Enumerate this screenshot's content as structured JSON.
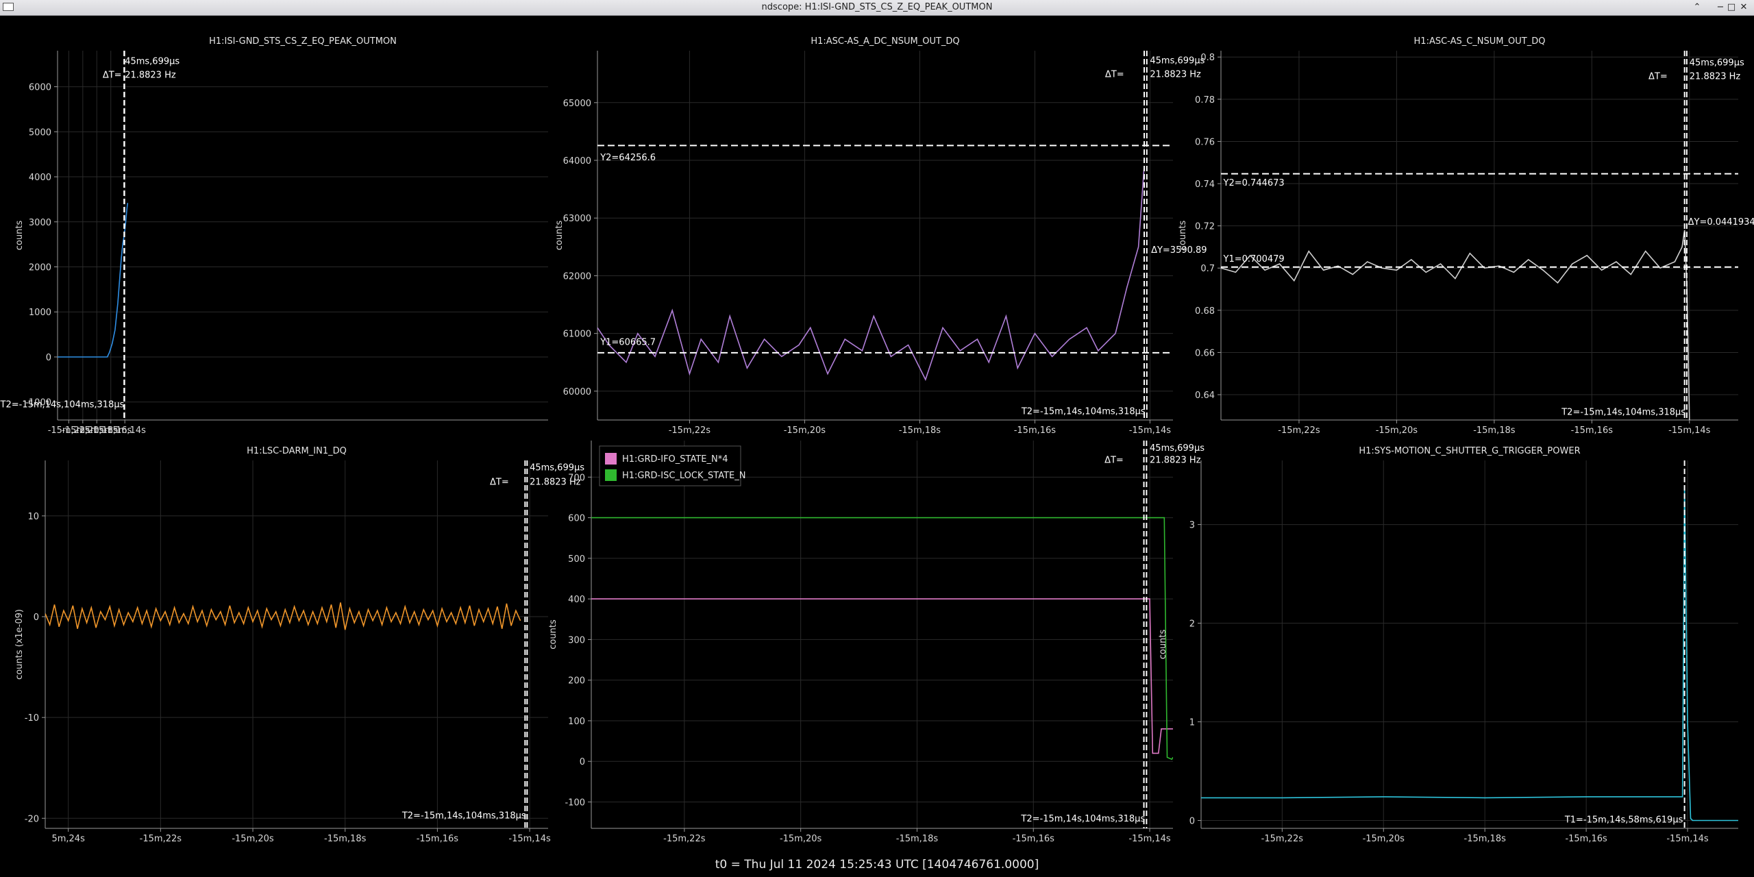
{
  "window": {
    "title": "ndscope: H1:ISI-GND_STS_CS_Z_EQ_PEAK_OUTMON"
  },
  "footer": {
    "t0": "t0 = Thu Jul 11 2024 15:25:43 UTC [1404746761.0000]"
  },
  "colors": {
    "background": "#000000",
    "grid": "#2a2a2a",
    "axis": "#9a9a9a",
    "cursor": "#ffffff"
  },
  "chart_data": [
    {
      "id": "p1",
      "type": "line",
      "title": "H1:ISI-GND_STS_CS_Z_EQ_PEAK_OUTMON",
      "ylabel": "counts",
      "xlim": [
        -923.6,
        -853.6
      ],
      "ylim": [
        -1400,
        6800
      ],
      "xticks": [
        -922,
        -920,
        -918,
        -916,
        -914
      ],
      "xtick_labels": [
        "-15m,22s",
        "-15m,20s",
        "-15m,18s",
        "-15m,16s",
        "-15m,14s"
      ],
      "yticks": [
        -1000,
        0,
        1000,
        2000,
        3000,
        4000,
        5000,
        6000
      ],
      "ytick_labels": [
        "-1000",
        "0",
        "1000",
        "2000",
        "3000",
        "4000",
        "5000",
        "6000"
      ],
      "series": [
        {
          "color": "#2f8fe6",
          "x": [
            -923.6,
            -916.5,
            -916.2,
            -915.8,
            -915.4,
            -915.0,
            -914.7,
            -914.5,
            -914.3,
            -914.1,
            -913.9,
            -913.7,
            -913.6
          ],
          "y": [
            0,
            0,
            100,
            300,
            600,
            1200,
            1800,
            2200,
            2500,
            2700,
            2950,
            3300,
            3420
          ]
        }
      ],
      "vcursors": [
        -914.1,
        -914.055
      ],
      "hcursors": [],
      "annotations": [
        {
          "text": "ΔT=",
          "x": -914.45,
          "y": 6200,
          "anchor": "end"
        },
        {
          "text": "45ms,699μs",
          "x": -914.0,
          "y": 6500,
          "anchor": "start"
        },
        {
          "text": "21.8823 Hz",
          "x": -914.0,
          "y": 6200,
          "anchor": "start"
        },
        {
          "text": "T2=-15m,14s,104ms,318μs",
          "x": -914.08,
          "y": -1120,
          "anchor": "end"
        }
      ]
    },
    {
      "id": "p2",
      "type": "line",
      "title": "H1:ASC-AS_A_DC_NSUM_OUT_DQ",
      "ylabel": "counts",
      "xlim": [
        -923.6,
        -913.6
      ],
      "ylim": [
        59500,
        65900
      ],
      "xticks": [
        -922,
        -920,
        -918,
        -916,
        -914
      ],
      "xtick_labels": [
        "-15m,22s",
        "-15m,20s",
        "-15m,18s",
        "-15m,16s",
        "-15m,14s"
      ],
      "yticks": [
        60000,
        61000,
        62000,
        63000,
        64000,
        65000
      ],
      "ytick_labels": [
        "60000",
        "61000",
        "62000",
        "63000",
        "64000",
        "65000"
      ],
      "series": [
        {
          "color": "#b07fd8",
          "x": [
            -923.6,
            -923.4,
            -923.1,
            -922.9,
            -922.6,
            -922.3,
            -922.0,
            -921.8,
            -921.5,
            -921.3,
            -921.0,
            -920.7,
            -920.4,
            -920.1,
            -919.9,
            -919.6,
            -919.3,
            -919.0,
            -918.8,
            -918.5,
            -918.2,
            -917.9,
            -917.6,
            -917.3,
            -917.0,
            -916.8,
            -916.5,
            -916.3,
            -916.0,
            -915.7,
            -915.4,
            -915.1,
            -914.9,
            -914.6,
            -914.4,
            -914.2,
            -914.1
          ],
          "y": [
            61100,
            60800,
            60500,
            61000,
            60600,
            61400,
            60300,
            60900,
            60500,
            61300,
            60400,
            60900,
            60600,
            60800,
            61100,
            60300,
            60900,
            60700,
            61300,
            60600,
            60800,
            60200,
            61100,
            60700,
            60900,
            60500,
            61300,
            60400,
            61000,
            60600,
            60900,
            61100,
            60700,
            61000,
            61800,
            62500,
            63900
          ]
        }
      ],
      "vcursors": [
        -914.1,
        -914.055
      ],
      "hcursors": [
        64256.6,
        60665.7
      ],
      "annotations": [
        {
          "text": "ΔT=",
          "x": -914.45,
          "y": 65440,
          "anchor": "end"
        },
        {
          "text": "45ms,699μs",
          "x": -914.0,
          "y": 65680,
          "anchor": "start"
        },
        {
          "text": "21.8823 Hz",
          "x": -914.0,
          "y": 65440,
          "anchor": "start"
        },
        {
          "text": "Y2=64256.6",
          "x": -923.55,
          "y": 64000,
          "anchor": "start"
        },
        {
          "text": "Y1=60665.7",
          "x": -923.55,
          "y": 60800,
          "anchor": "start"
        },
        {
          "text": "ΔY=3590.89",
          "x": -913.98,
          "y": 62400,
          "anchor": "start"
        },
        {
          "text": "T2=-15m,14s,104ms,318μs",
          "x": -914.08,
          "y": 59600,
          "anchor": "end"
        }
      ]
    },
    {
      "id": "p3",
      "type": "line",
      "title": "H1:ASC-AS_C_NSUM_OUT_DQ",
      "ylabel": "counts",
      "xlim": [
        -923.6,
        -913.0
      ],
      "ylim": [
        0.628,
        0.803
      ],
      "xticks": [
        -922,
        -920,
        -918,
        -916,
        -914
      ],
      "xtick_labels": [
        "-15m,22s",
        "-15m,20s",
        "-15m,18s",
        "-15m,16s",
        "-15m,14s"
      ],
      "yticks": [
        0.64,
        0.66,
        0.68,
        0.7,
        0.72,
        0.74,
        0.76,
        0.78,
        0.8
      ],
      "ytick_labels": [
        "0.64",
        "0.66",
        "0.68",
        "0.7",
        "0.72",
        "0.74",
        "0.76",
        "0.78",
        "0.8"
      ],
      "series": [
        {
          "color": "#cfcfcf",
          "x": [
            -923.6,
            -923.3,
            -923.0,
            -922.7,
            -922.4,
            -922.1,
            -921.8,
            -921.5,
            -921.2,
            -920.9,
            -920.6,
            -920.3,
            -920.0,
            -919.7,
            -919.4,
            -919.1,
            -918.8,
            -918.5,
            -918.2,
            -917.9,
            -917.6,
            -917.3,
            -917.0,
            -916.7,
            -916.4,
            -916.1,
            -915.8,
            -915.5,
            -915.2,
            -914.9,
            -914.6,
            -914.3,
            -914.15,
            -914.1,
            -914.05,
            -914.0
          ],
          "y": [
            0.7,
            0.698,
            0.706,
            0.699,
            0.702,
            0.694,
            0.708,
            0.699,
            0.701,
            0.697,
            0.703,
            0.7,
            0.699,
            0.704,
            0.698,
            0.702,
            0.695,
            0.707,
            0.7,
            0.701,
            0.698,
            0.704,
            0.699,
            0.693,
            0.702,
            0.706,
            0.699,
            0.703,
            0.697,
            0.708,
            0.7,
            0.703,
            0.71,
            0.718,
            0.69,
            0.628
          ]
        }
      ],
      "vcursors": [
        -914.1,
        -914.055
      ],
      "hcursors": [
        0.744673,
        0.700479
      ],
      "annotations": [
        {
          "text": "ΔT=",
          "x": -914.45,
          "y": 0.7895,
          "anchor": "end"
        },
        {
          "text": "45ms,699μs",
          "x": -914.0,
          "y": 0.796,
          "anchor": "start"
        },
        {
          "text": "21.8823 Hz",
          "x": -914.0,
          "y": 0.7895,
          "anchor": "start"
        },
        {
          "text": "Y2=0.744673",
          "x": -923.55,
          "y": 0.739,
          "anchor": "start"
        },
        {
          "text": "Y1=0.700479",
          "x": -923.55,
          "y": 0.703,
          "anchor": "start"
        },
        {
          "text": "ΔY=0.0441934",
          "x": -914.03,
          "y": 0.7205,
          "anchor": "start"
        },
        {
          "text": "T2=-15m,14s,104ms,318μs",
          "x": -914.08,
          "y": 0.6305,
          "anchor": "end"
        }
      ]
    },
    {
      "id": "p4",
      "type": "line",
      "title": "H1:LSC-DARM_IN1_DQ",
      "ylabel": "counts (x1e-09)",
      "xlim": [
        -924.5,
        -913.6
      ],
      "ylim": [
        -21,
        15.5
      ],
      "xticks": [
        -924,
        -922,
        -920,
        -918,
        -916,
        -914
      ],
      "xtick_labels": [
        "5m,24s",
        "-15m,22s",
        "-15m,20s",
        "-15m,18s",
        "-15m,16s",
        "-15m,14s"
      ],
      "yticks": [
        -20,
        -10,
        0,
        10
      ],
      "ytick_labels": [
        "-20",
        "-10",
        "0",
        "10"
      ],
      "series": [
        {
          "color": "#f0962a",
          "x": [
            -924.5,
            -924.4,
            -924.3,
            -924.2,
            -924.1,
            -924.0,
            -923.9,
            -923.8,
            -923.7,
            -923.6,
            -923.5,
            -923.4,
            -923.3,
            -923.2,
            -923.1,
            -923.0,
            -922.9,
            -922.8,
            -922.7,
            -922.6,
            -922.5,
            -922.4,
            -922.3,
            -922.2,
            -922.1,
            -922.0,
            -921.9,
            -921.8,
            -921.7,
            -921.6,
            -921.5,
            -921.4,
            -921.3,
            -921.2,
            -921.1,
            -921.0,
            -920.9,
            -920.8,
            -920.7,
            -920.6,
            -920.5,
            -920.4,
            -920.3,
            -920.2,
            -920.1,
            -920.0,
            -919.9,
            -919.8,
            -919.7,
            -919.6,
            -919.5,
            -919.4,
            -919.3,
            -919.2,
            -919.1,
            -919.0,
            -918.9,
            -918.8,
            -918.7,
            -918.6,
            -918.5,
            -918.4,
            -918.3,
            -918.2,
            -918.1,
            -918.0,
            -917.9,
            -917.8,
            -917.7,
            -917.6,
            -917.5,
            -917.4,
            -917.3,
            -917.2,
            -917.1,
            -917.0,
            -916.9,
            -916.8,
            -916.7,
            -916.6,
            -916.5,
            -916.4,
            -916.3,
            -916.2,
            -916.1,
            -916.0,
            -915.9,
            -915.8,
            -915.7,
            -915.6,
            -915.5,
            -915.4,
            -915.3,
            -915.2,
            -915.1,
            -915.0,
            -914.9,
            -914.8,
            -914.7,
            -914.6,
            -914.5,
            -914.4,
            -914.3,
            -914.2
          ],
          "y": [
            0.3,
            -0.8,
            1.2,
            -1.0,
            0.6,
            -0.4,
            1.1,
            -1.2,
            0.8,
            -0.6,
            0.9,
            -1.1,
            0.5,
            -0.3,
            1.0,
            -0.9,
            0.7,
            -0.8,
            0.4,
            -0.5,
            0.9,
            -0.7,
            0.6,
            -1.0,
            0.8,
            -0.4,
            0.5,
            -0.8,
            0.9,
            -0.6,
            0.3,
            -0.7,
            1.0,
            -0.5,
            0.6,
            -0.9,
            0.7,
            -0.3,
            0.5,
            -0.8,
            1.1,
            -0.6,
            0.4,
            -0.7,
            0.9,
            -0.5,
            0.6,
            -1.0,
            0.8,
            -0.3,
            0.5,
            -0.9,
            0.7,
            -0.6,
            1.0,
            -0.4,
            0.6,
            -0.8,
            0.5,
            -0.7,
            0.9,
            -0.5,
            1.2,
            -1.1,
            1.4,
            -1.3,
            0.8,
            -0.6,
            0.5,
            -0.9,
            0.7,
            -0.4,
            0.6,
            -0.8,
            0.9,
            -0.5,
            0.4,
            -0.7,
            1.0,
            -0.6,
            0.5,
            -0.8,
            0.7,
            -0.3,
            0.6,
            -0.9,
            0.8,
            -0.5,
            0.4,
            -0.7,
            0.9,
            -0.6,
            1.1,
            -0.9,
            0.7,
            -0.5,
            0.8,
            -0.7,
            1.0,
            -1.2,
            1.3,
            -0.9,
            0.6,
            -0.4
          ]
        }
      ],
      "vcursors": [
        -914.1,
        -914.055
      ],
      "hcursors": [],
      "annotations": [
        {
          "text": "ΔT=",
          "x": -914.45,
          "y": 13.1,
          "anchor": "end"
        },
        {
          "text": "45ms,699μs",
          "x": -914.0,
          "y": 14.5,
          "anchor": "start"
        },
        {
          "text": "21.8823 Hz",
          "x": -914.0,
          "y": 13.1,
          "anchor": "start"
        },
        {
          "text": "T2=-15m,14s,104ms,318μs",
          "x": -914.08,
          "y": -20.0,
          "anchor": "end"
        }
      ]
    },
    {
      "id": "p5",
      "type": "line",
      "title": "",
      "ylabel": "counts",
      "xlim": [
        -923.6,
        -913.6
      ],
      "ylim": [
        -165,
        790
      ],
      "xticks": [
        -922,
        -920,
        -918,
        -916,
        -914
      ],
      "xtick_labels": [
        "-15m,22s",
        "-15m,20s",
        "-15m,18s",
        "-15m,16s",
        "-15m,14s"
      ],
      "yticks": [
        -100,
        0,
        100,
        200,
        300,
        400,
        500,
        600,
        700
      ],
      "ytick_labels": [
        "-100",
        "0",
        "100",
        "200",
        "300",
        "400",
        "500",
        "600",
        "700"
      ],
      "legend": [
        "H1:GRD-IFO_STATE_N*4",
        "H1:GRD-ISC_LOCK_STATE_N"
      ],
      "series": [
        {
          "name": "H1:GRD-IFO_STATE_N*4",
          "color": "#e07ac7",
          "x": [
            -923.6,
            -914.2,
            -914.0,
            -913.95,
            -913.85,
            -913.8,
            -913.6
          ],
          "y": [
            400,
            400,
            400,
            20,
            20,
            80,
            80
          ]
        },
        {
          "name": "H1:GRD-ISC_LOCK_STATE_N",
          "color": "#2fb82f",
          "x": [
            -923.6,
            -914.2,
            -913.75,
            -913.7,
            -913.62,
            -913.6
          ],
          "y": [
            600,
            600,
            600,
            10,
            5,
            10
          ]
        }
      ],
      "vcursors": [
        -914.1,
        -914.055
      ],
      "hcursors": [],
      "annotations": [
        {
          "text": "ΔT=",
          "x": -914.45,
          "y": 735,
          "anchor": "end"
        },
        {
          "text": "45ms,699μs",
          "x": -914.0,
          "y": 765,
          "anchor": "start"
        },
        {
          "text": "21.8823 Hz",
          "x": -914.0,
          "y": 735,
          "anchor": "start"
        },
        {
          "text": "T2=-15m,14s,104ms,318μs",
          "x": -914.08,
          "y": -148,
          "anchor": "end"
        }
      ]
    },
    {
      "id": "p6",
      "type": "line",
      "title": "H1:SYS-MOTION_C_SHUTTER_G_TRIGGER_POWER",
      "ylabel": "counts",
      "xlim": [
        -923.6,
        -913.0
      ],
      "ylim": [
        -0.08,
        3.65
      ],
      "xticks": [
        -922,
        -920,
        -918,
        -916,
        -914
      ],
      "xtick_labels": [
        "-15m,22s",
        "-15m,20s",
        "-15m,18s",
        "-15m,16s",
        "-15m,14s"
      ],
      "yticks": [
        0,
        1,
        2,
        3
      ],
      "ytick_labels": [
        "0",
        "1",
        "2",
        "3"
      ],
      "series": [
        {
          "color": "#2ec4dc",
          "x": [
            -923.6,
            -922.0,
            -920.0,
            -918.0,
            -916.0,
            -914.1,
            -914.06,
            -914.04,
            -914.0,
            -913.97,
            -913.94,
            -913.9,
            -913.0
          ],
          "y": [
            0.23,
            0.23,
            0.24,
            0.23,
            0.24,
            0.24,
            3.4,
            2.6,
            1.0,
            0.5,
            0.02,
            0.0,
            0.0
          ]
        }
      ],
      "vcursors": [
        -914.06
      ],
      "hcursors": [],
      "annotations": [
        {
          "text": "T1=-15m,14s,58ms,619μs",
          "x": -914.09,
          "y": -0.02,
          "anchor": "end"
        }
      ]
    }
  ]
}
